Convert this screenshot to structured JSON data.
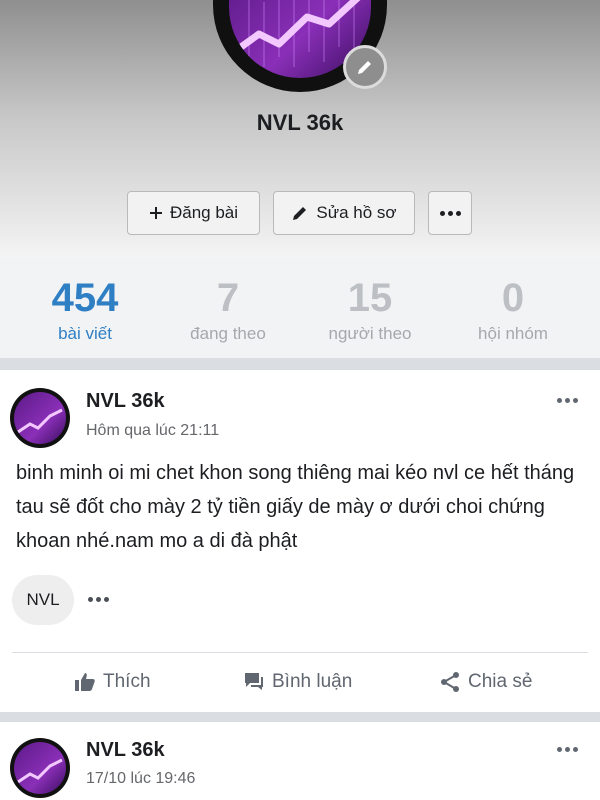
{
  "profile": {
    "name": "NVL 36k",
    "buttons": {
      "post": "Đăng bài",
      "edit": "Sửa hồ sơ"
    }
  },
  "stats": [
    {
      "value": "454",
      "label": "bài viết"
    },
    {
      "value": "7",
      "label": "đang theo"
    },
    {
      "value": "15",
      "label": "người theo"
    },
    {
      "value": "0",
      "label": "hội nhóm"
    }
  ],
  "posts": [
    {
      "author": "NVL 36k",
      "time": "Hôm qua lúc 21:11",
      "content": "binh minh oi mi chet khon song thiêng mai kéo nvl ce hết tháng tau sẽ đốt cho mày 2 tỷ tiền giấy de mày ơ dưới choi chứng khoan nhé.nam mo a di đà phật",
      "tag": "NVL"
    },
    {
      "author": "NVL 36k",
      "time": "17/10 lúc 19:46"
    }
  ],
  "actions": {
    "like": "Thích",
    "comment": "Bình luận",
    "share": "Chia sẻ"
  },
  "colors": {
    "accent": "#2f7fc4",
    "muted": "#bcc0c4",
    "avatar_purple": "#8a2fb8"
  },
  "icons": [
    "plus-icon",
    "pencil-icon",
    "more-icon",
    "like-icon",
    "comment-icon",
    "share-icon"
  ]
}
